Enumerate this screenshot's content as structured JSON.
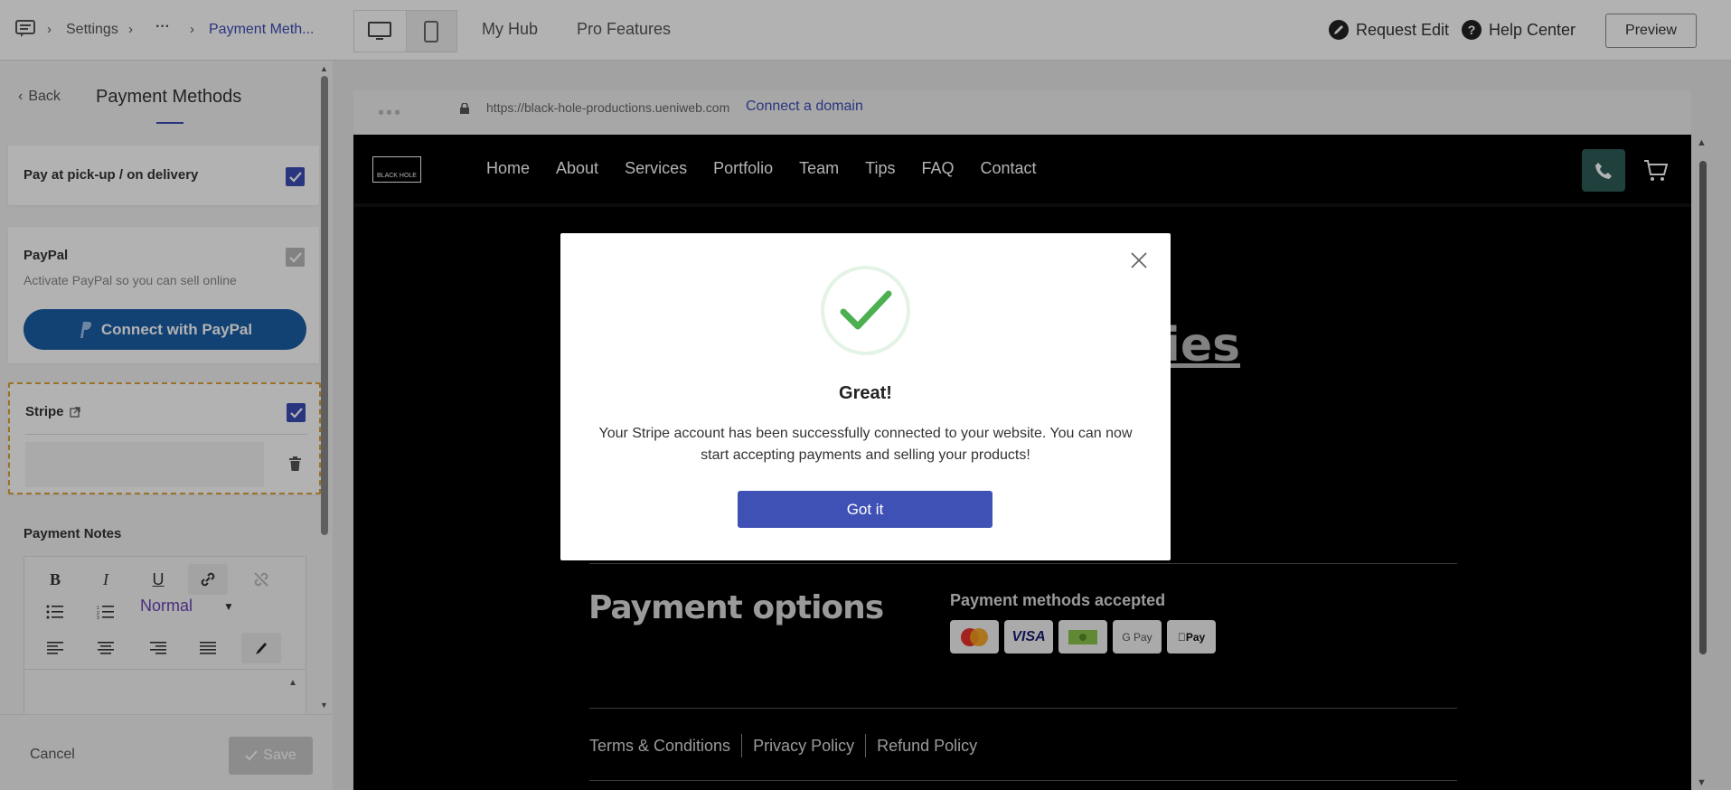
{
  "topbar": {
    "breadcrumb": {
      "root": "Settings",
      "ellipsis": "···",
      "current": "Payment Meth..."
    },
    "nav": {
      "my_hub": "My Hub",
      "pro_features": "Pro Features"
    },
    "request_edit": "Request Edit",
    "help_center": "Help Center",
    "preview": "Preview"
  },
  "panel": {
    "back": "Back",
    "title": "Payment Methods",
    "pickup": {
      "label": "Pay at pick-up / on delivery",
      "checked": true
    },
    "paypal": {
      "label": "PayPal",
      "sub": "Activate PayPal so you can sell online",
      "button": "Connect with PayPal",
      "checked": true
    },
    "stripe": {
      "label": "Stripe",
      "checked": true
    },
    "notes": {
      "label": "Payment Notes",
      "format": "Normal"
    },
    "cancel": "Cancel",
    "save": "Save"
  },
  "browser": {
    "url": "https://black-hole-productions.ueniweb.com",
    "connect_domain": "Connect a domain"
  },
  "site": {
    "logo": "BLACK HOLE",
    "nav": [
      "Home",
      "About",
      "Services",
      "Portfolio",
      "Team",
      "Tips",
      "FAQ",
      "Contact"
    ],
    "hero_fragment": "ies",
    "payment_title": "Payment options",
    "methods_label": "Payment methods accepted",
    "badges": [
      "mastercard",
      "VISA",
      "cash",
      "G Pay",
      "Pay"
    ],
    "footer": [
      "Terms & Conditions",
      "Privacy Policy",
      "Refund Policy"
    ]
  },
  "modal": {
    "title": "Great!",
    "body": "Your Stripe account has been successfully connected to your website. You can now start accepting payments and selling your products!",
    "button": "Got it"
  },
  "colors": {
    "accent": "#3d4db7",
    "paypal": "#1b5ea6",
    "success": "#4caf50",
    "stripe_border": "#e0a33a",
    "phone_btn": "#2f5c5a"
  }
}
